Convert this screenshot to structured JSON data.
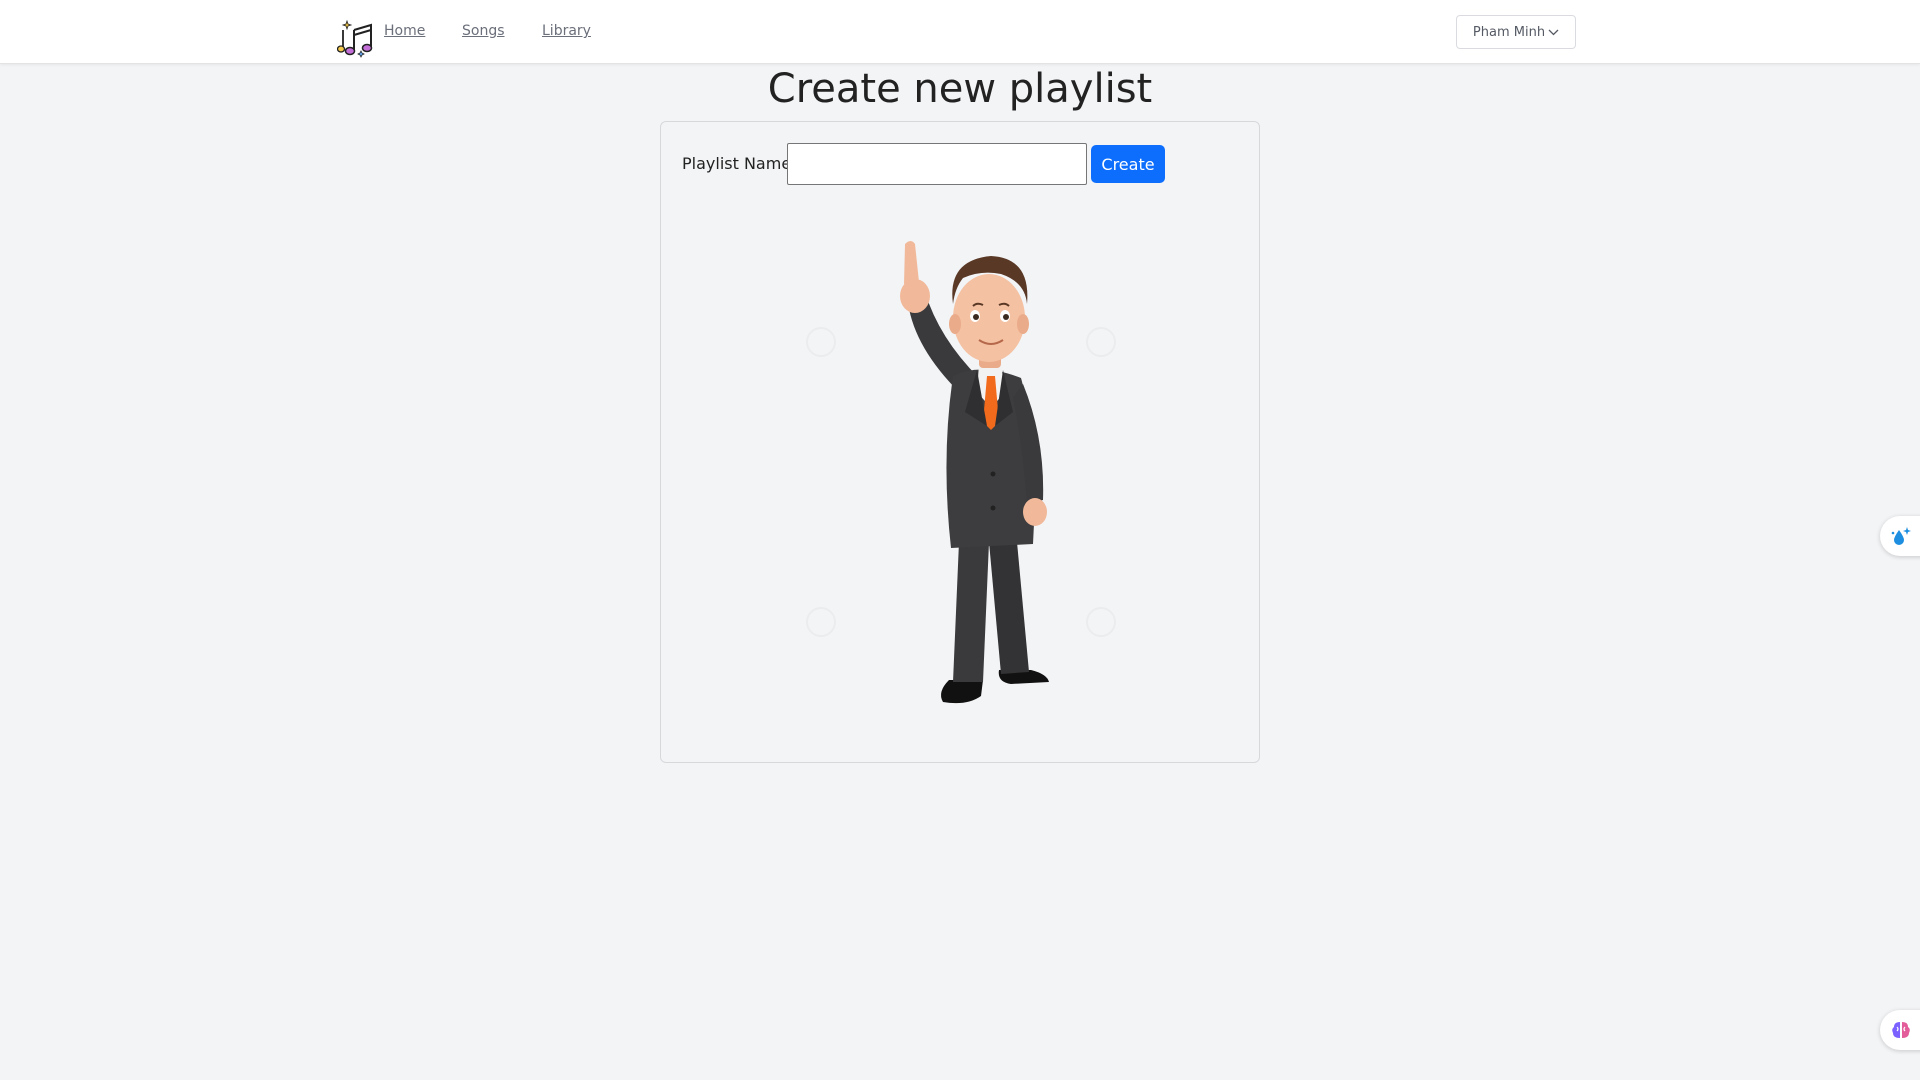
{
  "nav": {
    "links": [
      {
        "label": "Home"
      },
      {
        "label": "Songs"
      },
      {
        "label": "Library"
      }
    ],
    "user_menu": {
      "label": "Pham Minh"
    }
  },
  "page": {
    "title": "Create new playlist"
  },
  "form": {
    "name_label": "Playlist Name:",
    "name_value": "",
    "name_placeholder": "",
    "submit_label": "Create"
  },
  "icons": {
    "logo": "music-notes-icon",
    "user_menu_chevron": "chevron-down-icon",
    "side_button_top": "sparkle-drop-icon",
    "side_button_bottom": "brain-icon"
  },
  "colors": {
    "primary": "#0d6efd",
    "background": "#f3f4f6",
    "suit": "#3a3a3c",
    "tie": "#f26a1b"
  }
}
